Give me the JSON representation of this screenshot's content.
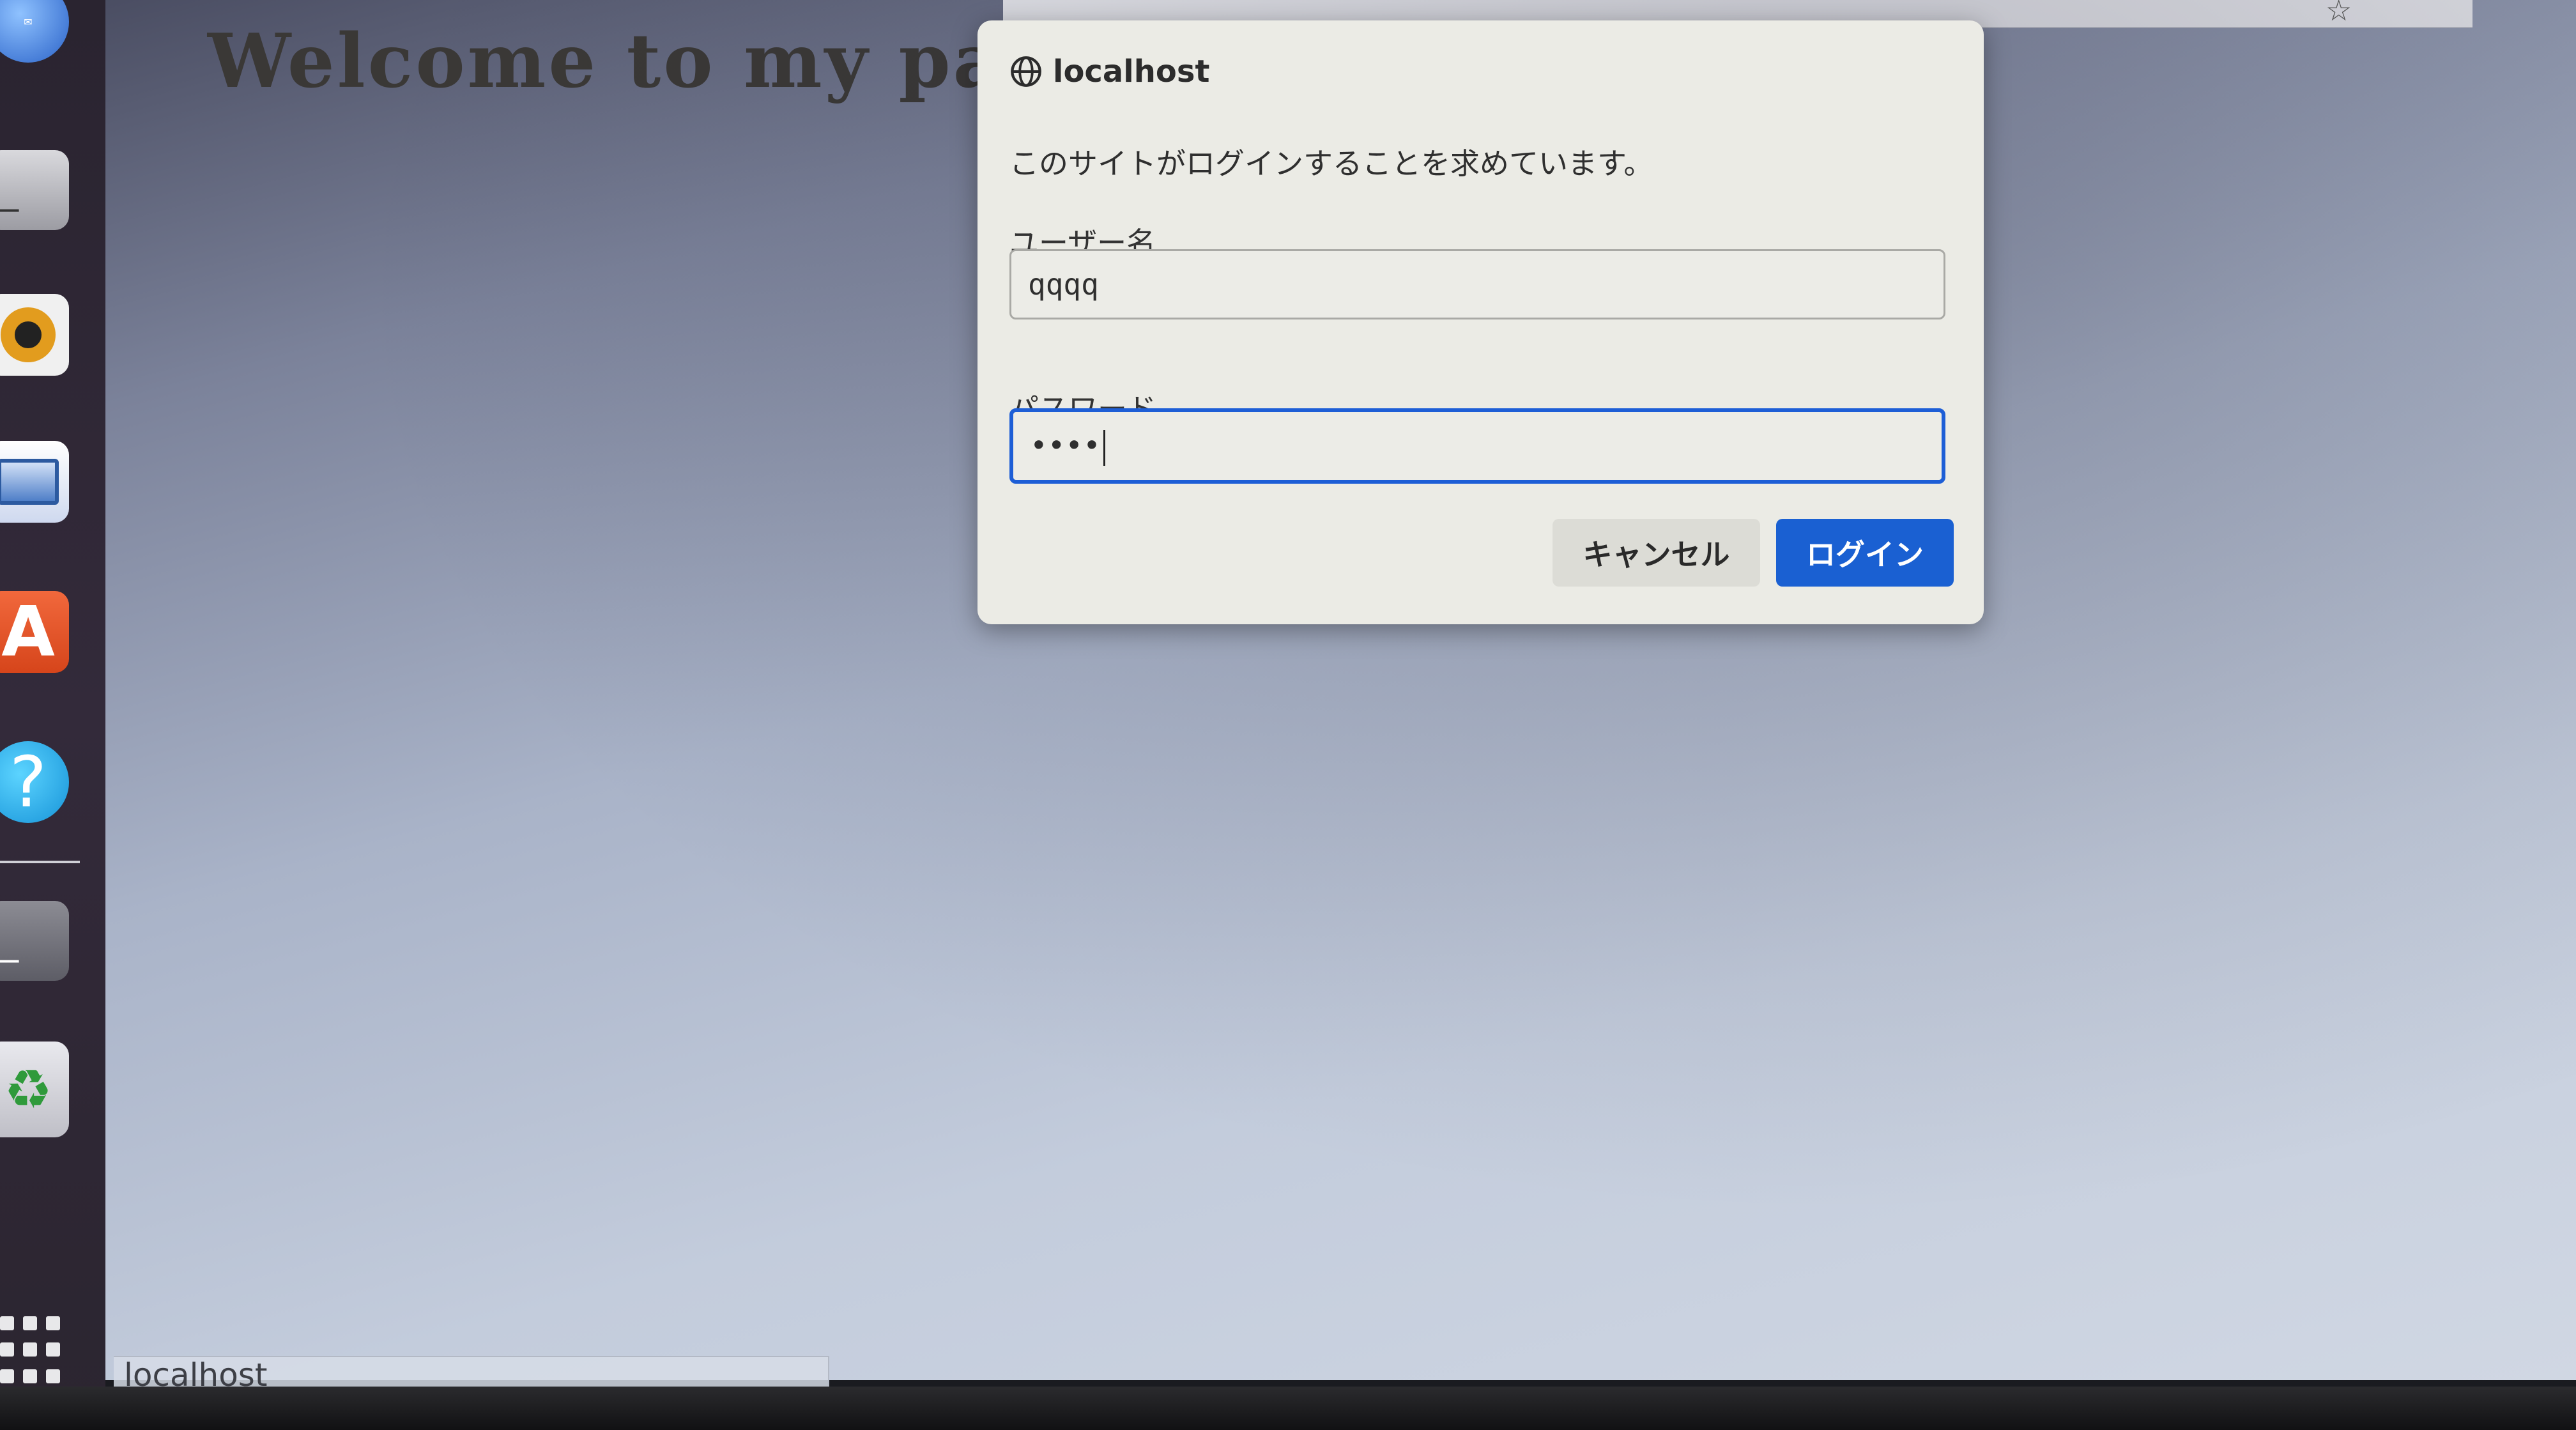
{
  "page": {
    "heading": "Welcome to my page"
  },
  "status_bar": {
    "text": "localhost"
  },
  "dialog": {
    "origin": "localhost",
    "message": "このサイトがログインすることを求めています。",
    "username_label": "ユーザー名",
    "username_value": "qqqq",
    "password_label": "パスワード",
    "password_masked": "••••",
    "cancel_label": "キャンセル",
    "login_label": "ログイン"
  },
  "dock": {
    "items": [
      {
        "icon": "thunderbird-icon"
      },
      {
        "icon": "terminal-icon",
        "glyph": "_"
      },
      {
        "icon": "rhythmbox-icon"
      },
      {
        "icon": "libreoffice-writer-icon"
      },
      {
        "icon": "software-center-icon",
        "glyph": "A"
      },
      {
        "icon": "help-icon",
        "glyph": "?"
      },
      {
        "icon": "terminal-icon",
        "glyph": "_"
      },
      {
        "icon": "trash-icon",
        "glyph": "♻"
      },
      {
        "icon": "show-apps-icon"
      }
    ]
  },
  "colors": {
    "accent": "#1a60d2",
    "dialog_bg": "#ebebe5",
    "focus_border": "#1d5ed6"
  }
}
